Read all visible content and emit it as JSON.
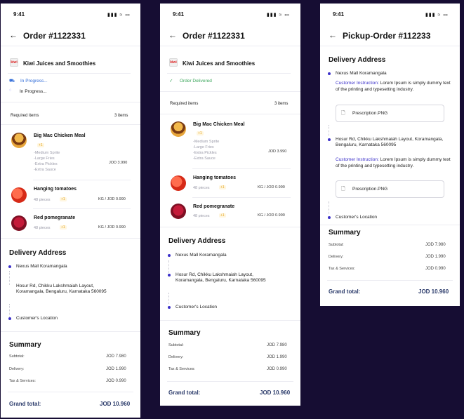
{
  "status_bar": {
    "time": "9:41",
    "icons": "▮▮▮ ≈ ▭"
  },
  "screens": {
    "order_in_progress": {
      "title": "Order #1122331",
      "store_name": "Kiwi Juices and Smoothies",
      "logo_text": "kiwi",
      "statuses": [
        "In Progress...",
        "In Progress..."
      ],
      "required_items_label": "Required items",
      "items_count": "3 items",
      "items": [
        {
          "name": "Big Mac Chicken Meal",
          "qty": "+1",
          "options": [
            "-Medium Sprite",
            "-Large Fries",
            "-Extra Pickles",
            "-Extra Sauce"
          ],
          "price": "JOD 3.990"
        },
        {
          "name": "Hanging tomatoes",
          "pieces": "48 pieces",
          "qty": "+1",
          "price": "KG / JOD 0.990"
        },
        {
          "name": "Red pomegranate",
          "pieces": "48 pieces",
          "qty": "+1",
          "price": "KG / JOD 0.990"
        }
      ],
      "delivery_title": "Delivery Address",
      "addresses": [
        "Nexus Mall Koramangala",
        "Hosur Rd, Chikku Lakshmaiah Layout, Koramangala, Bengaluru, Karnataka 560095",
        "Customer's Location"
      ],
      "summary_title": "Summary",
      "summary": [
        {
          "label": "Subtotal:",
          "value": "JOD 7.980"
        },
        {
          "label": "Delivery:",
          "value": "JOD 1.990"
        },
        {
          "label": "Tax & Services:",
          "value": "JOD 0.990"
        }
      ],
      "grand_total_label": "Grand total:",
      "grand_total_value": "JOD 10.960"
    },
    "order_delivered": {
      "title": "Order #1122331",
      "store_name": "Kiwi Juices and Smoothies",
      "logo_text": "kiwi",
      "status": "Order Delivered",
      "required_items_label": "Required items",
      "items_count": "3 items",
      "items": [
        {
          "name": "Big Mac Chicken Meal",
          "qty": "+1",
          "options": [
            "-Medium Sprite",
            "-Large Fries",
            "-Extra Pickles",
            "-Extra Sauce"
          ],
          "price": "JOD 3.990"
        },
        {
          "name": "Hanging tomatoes",
          "pieces": "48 pieces",
          "qty": "+1",
          "price": "KG / JOD 0.990"
        },
        {
          "name": "Red pomegranate",
          "pieces": "48 pieces",
          "qty": "+1",
          "price": "KG / JOD 0.990"
        }
      ],
      "delivery_title": "Delivery Address",
      "addresses": [
        "Nexus Mall Koramangala",
        "Hosur Rd, Chikku Lakshmaiah Layout, Koramangala, Bengaluru, Karnataka 560095",
        "Customer's Location"
      ],
      "summary_title": "Summary",
      "summary": [
        {
          "label": "Subtotal:",
          "value": "JOD 7.980"
        },
        {
          "label": "Delivery:",
          "value": "JOD 1.990"
        },
        {
          "label": "Tax & Services:",
          "value": "JOD 0.990"
        }
      ],
      "grand_total_label": "Grand total:",
      "grand_total_value": "JOD 10.960"
    },
    "pickup_order": {
      "title": "Pickup-Order #112233",
      "delivery_title": "Delivery Address",
      "stops": [
        {
          "address": "Nexus Mall Koramangala",
          "instruction_label": "Customer Instruction:",
          "instruction_text": "Lorem Ipsum is simply dummy text of the printing and typesetting industry.",
          "file": "Prescription.PNG"
        },
        {
          "address": "Hosur Rd, Chikku Lakshmaiah Layout, Koramangala, Bengaluru, Karnataka 560095",
          "instruction_label": "Customer Instruction:",
          "instruction_text": "Lorem Ipsum is simply dummy text of the printing and typesetting industry.",
          "file": "Prescription.PNG"
        }
      ],
      "final_stop": "Customer's Location",
      "summary_title": "Summary",
      "summary": [
        {
          "label": "Subtotal:",
          "value": "JOD 7.980"
        },
        {
          "label": "Delivery:",
          "value": "JOD 1.990"
        },
        {
          "label": "Tax & Services:",
          "value": "JOD 0.990"
        }
      ],
      "grand_total_label": "Grand total:",
      "grand_total_value": "JOD 10.960"
    }
  }
}
